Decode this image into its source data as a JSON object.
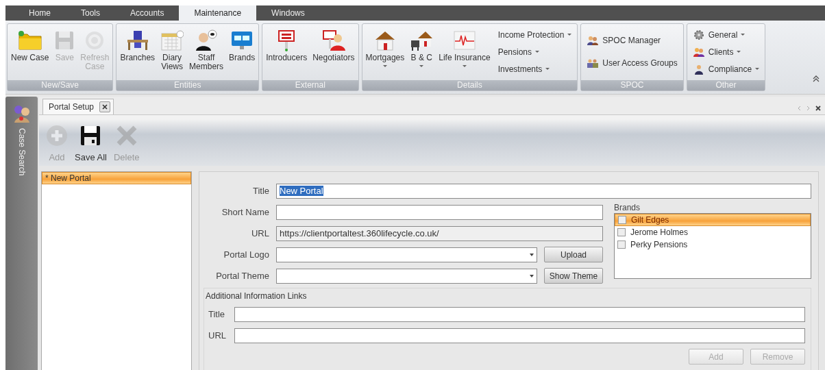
{
  "menu_tabs": [
    {
      "label": "Home",
      "selected": false
    },
    {
      "label": "Tools",
      "selected": false
    },
    {
      "label": "Accounts",
      "selected": false
    },
    {
      "label": "Maintenance",
      "selected": true
    },
    {
      "label": "Windows",
      "selected": false
    }
  ],
  "ribbon": {
    "groups": [
      {
        "title": "New/Save",
        "items": [
          {
            "kind": "large",
            "lines": [
              "New Case"
            ],
            "disabled": false,
            "dropdown": false
          },
          {
            "kind": "large",
            "lines": [
              "Save"
            ],
            "disabled": true,
            "dropdown": false
          },
          {
            "kind": "large",
            "lines": [
              "Refresh",
              "Case"
            ],
            "disabled": true,
            "dropdown": false
          }
        ]
      },
      {
        "title": "Entities",
        "items": [
          {
            "kind": "large",
            "lines": [
              "Branches"
            ],
            "disabled": false,
            "dropdown": false
          },
          {
            "kind": "large",
            "lines": [
              "Diary",
              "Views"
            ],
            "disabled": false,
            "dropdown": false
          },
          {
            "kind": "large",
            "lines": [
              "Staff",
              "Members"
            ],
            "disabled": false,
            "dropdown": false
          },
          {
            "kind": "large",
            "lines": [
              "Brands"
            ],
            "disabled": false,
            "dropdown": false
          }
        ]
      },
      {
        "title": "External",
        "items": [
          {
            "kind": "large",
            "lines": [
              "Introducers"
            ],
            "disabled": false,
            "dropdown": false
          },
          {
            "kind": "large",
            "lines": [
              "Negotiators"
            ],
            "disabled": false,
            "dropdown": false
          }
        ]
      },
      {
        "title": "Details",
        "items": [
          {
            "kind": "large",
            "lines": [
              "Mortgages"
            ],
            "disabled": false,
            "dropdown": true
          },
          {
            "kind": "large",
            "lines": [
              "B & C"
            ],
            "disabled": false,
            "dropdown": true
          },
          {
            "kind": "large",
            "lines": [
              "Life Insurance"
            ],
            "disabled": false,
            "dropdown": true
          },
          {
            "kind": "small",
            "lines": [
              "Income Protection"
            ],
            "disabled": false,
            "dropdown": true
          },
          {
            "kind": "small",
            "lines": [
              "Pensions"
            ],
            "disabled": false,
            "dropdown": true
          },
          {
            "kind": "small",
            "lines": [
              "Investments"
            ],
            "disabled": false,
            "dropdown": true
          }
        ]
      },
      {
        "title": "SPOC",
        "items": [
          {
            "kind": "small",
            "lines": [
              "SPOC Manager"
            ],
            "disabled": false,
            "dropdown": false
          },
          {
            "kind": "small",
            "lines": [
              "User Access Groups"
            ],
            "disabled": false,
            "dropdown": false
          }
        ]
      },
      {
        "title": "Other",
        "items": [
          {
            "kind": "small",
            "lines": [
              "General"
            ],
            "disabled": false,
            "dropdown": true
          },
          {
            "kind": "small",
            "lines": [
              "Clients"
            ],
            "disabled": false,
            "dropdown": true
          },
          {
            "kind": "small",
            "lines": [
              "Compliance"
            ],
            "disabled": false,
            "dropdown": true
          }
        ]
      }
    ]
  },
  "side_panel": {
    "label": "Case Search"
  },
  "document_tabs": [
    {
      "label": "Portal Setup",
      "selected": true
    }
  ],
  "toolbar": [
    {
      "label": "Add",
      "disabled": true
    },
    {
      "label": "Save All",
      "disabled": false
    },
    {
      "label": "Delete",
      "disabled": true
    }
  ],
  "portal_list": [
    {
      "label": "* New Portal",
      "selected": true
    }
  ],
  "form": {
    "fields": [
      {
        "label": "Title",
        "kind": "text",
        "value": "New Portal",
        "text_selected": true
      },
      {
        "label": "Short Name",
        "kind": "text"
      },
      {
        "label": "URL",
        "kind": "readonly",
        "value": "https://clientportaltest.360lifecycle.co.uk/"
      },
      {
        "label": "Portal Logo",
        "kind": "combo",
        "button": "Upload"
      },
      {
        "label": "Portal Theme",
        "kind": "combo",
        "button": "Show Theme"
      }
    ],
    "brands": {
      "title": "Brands",
      "items": [
        {
          "label": "Gilt Edges",
          "checked": false,
          "selected": true
        },
        {
          "label": "Jerome Holmes",
          "checked": false,
          "selected": false
        },
        {
          "label": "Perky Pensions",
          "checked": false,
          "selected": false
        }
      ]
    },
    "links": {
      "title": "Additional Information Links",
      "fields": [
        {
          "label": "Title"
        },
        {
          "label": "URL"
        }
      ],
      "buttons": [
        {
          "label": "Add",
          "disabled": true
        },
        {
          "label": "Remove",
          "disabled": true
        }
      ]
    }
  }
}
